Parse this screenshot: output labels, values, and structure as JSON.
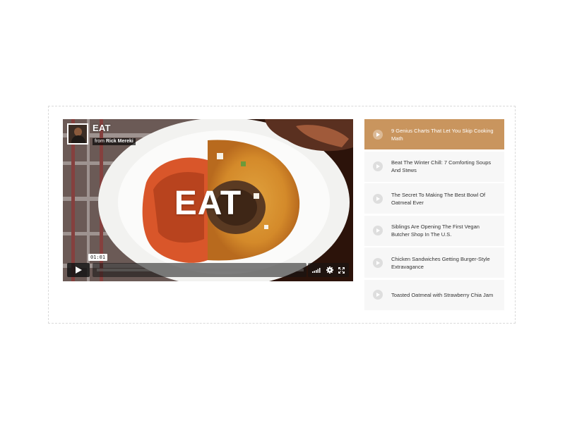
{
  "video": {
    "title": "EAT",
    "byline_prefix": "from",
    "author": "Rick Mereki",
    "center_title": "EAT",
    "time": "01:01",
    "progress": 0.0
  },
  "playlist": [
    {
      "title": "9 Genius Charts That Let You Skip Cooking Math",
      "active": true
    },
    {
      "title": "Beat The Winter Chill: 7 Comforting Soups And Stews",
      "active": false
    },
    {
      "title": "The Secret To Making The Best Bowl Of Oatmeal Ever",
      "active": false
    },
    {
      "title": "Siblings Are Opening The First Vegan Butcher Shop In The U.S.",
      "active": false
    },
    {
      "title": "Chicken Sandwiches Getting Burger-Style Extravagance",
      "active": false
    },
    {
      "title": "Toasted Oatmeal with Strawberry Chia Jam",
      "active": false
    }
  ],
  "colors": {
    "accent": "#c9955e",
    "playlist_bg": "#f7f7f7"
  },
  "icons": {
    "play": "play-icon",
    "volume": "volume-icon",
    "settings": "gear-icon",
    "fullscreen": "fullscreen-icon"
  }
}
